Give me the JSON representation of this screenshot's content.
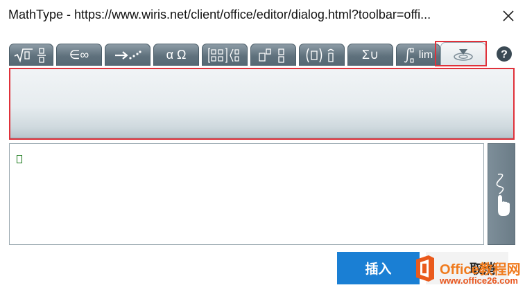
{
  "window": {
    "title": "MathType - https://www.wiris.net/client/office/editor/dialog.html?toolbar=offi..."
  },
  "tabs": [
    {
      "name": "tab-general",
      "icon": "sqrt-fraction-icon"
    },
    {
      "name": "tab-symbols",
      "label": "∈∞",
      "icon": "symbols-icon"
    },
    {
      "name": "tab-arrows",
      "icon": "arrows-icon"
    },
    {
      "name": "tab-greek",
      "label": "α Ω",
      "icon": "greek-icon"
    },
    {
      "name": "tab-matrices",
      "icon": "matrix-icon"
    },
    {
      "name": "tab-scripts",
      "icon": "scripts-icon"
    },
    {
      "name": "tab-decorations",
      "icon": "brackets-icon"
    },
    {
      "name": "tab-big-operators",
      "label": "Σ∪",
      "icon": "sum-union-icon"
    },
    {
      "name": "tab-calculus",
      "label": "lim",
      "icon": "integral-lim-icon"
    },
    {
      "name": "tab-contextual",
      "icon": "contextual-icon",
      "active": true
    }
  ],
  "help": {
    "icon": "help-icon"
  },
  "editor": {
    "caret_icon": "placeholder-box-icon"
  },
  "handwriting": {
    "icon": "hand-write-icon"
  },
  "buttons": {
    "insert": "插入",
    "cancel": "取消"
  },
  "watermark": {
    "name": "Office教程网",
    "url": "www.office26.com"
  },
  "colors": {
    "accent": "#1a7fd4",
    "highlight": "#e0313a",
    "tab": "#6b7c87"
  }
}
